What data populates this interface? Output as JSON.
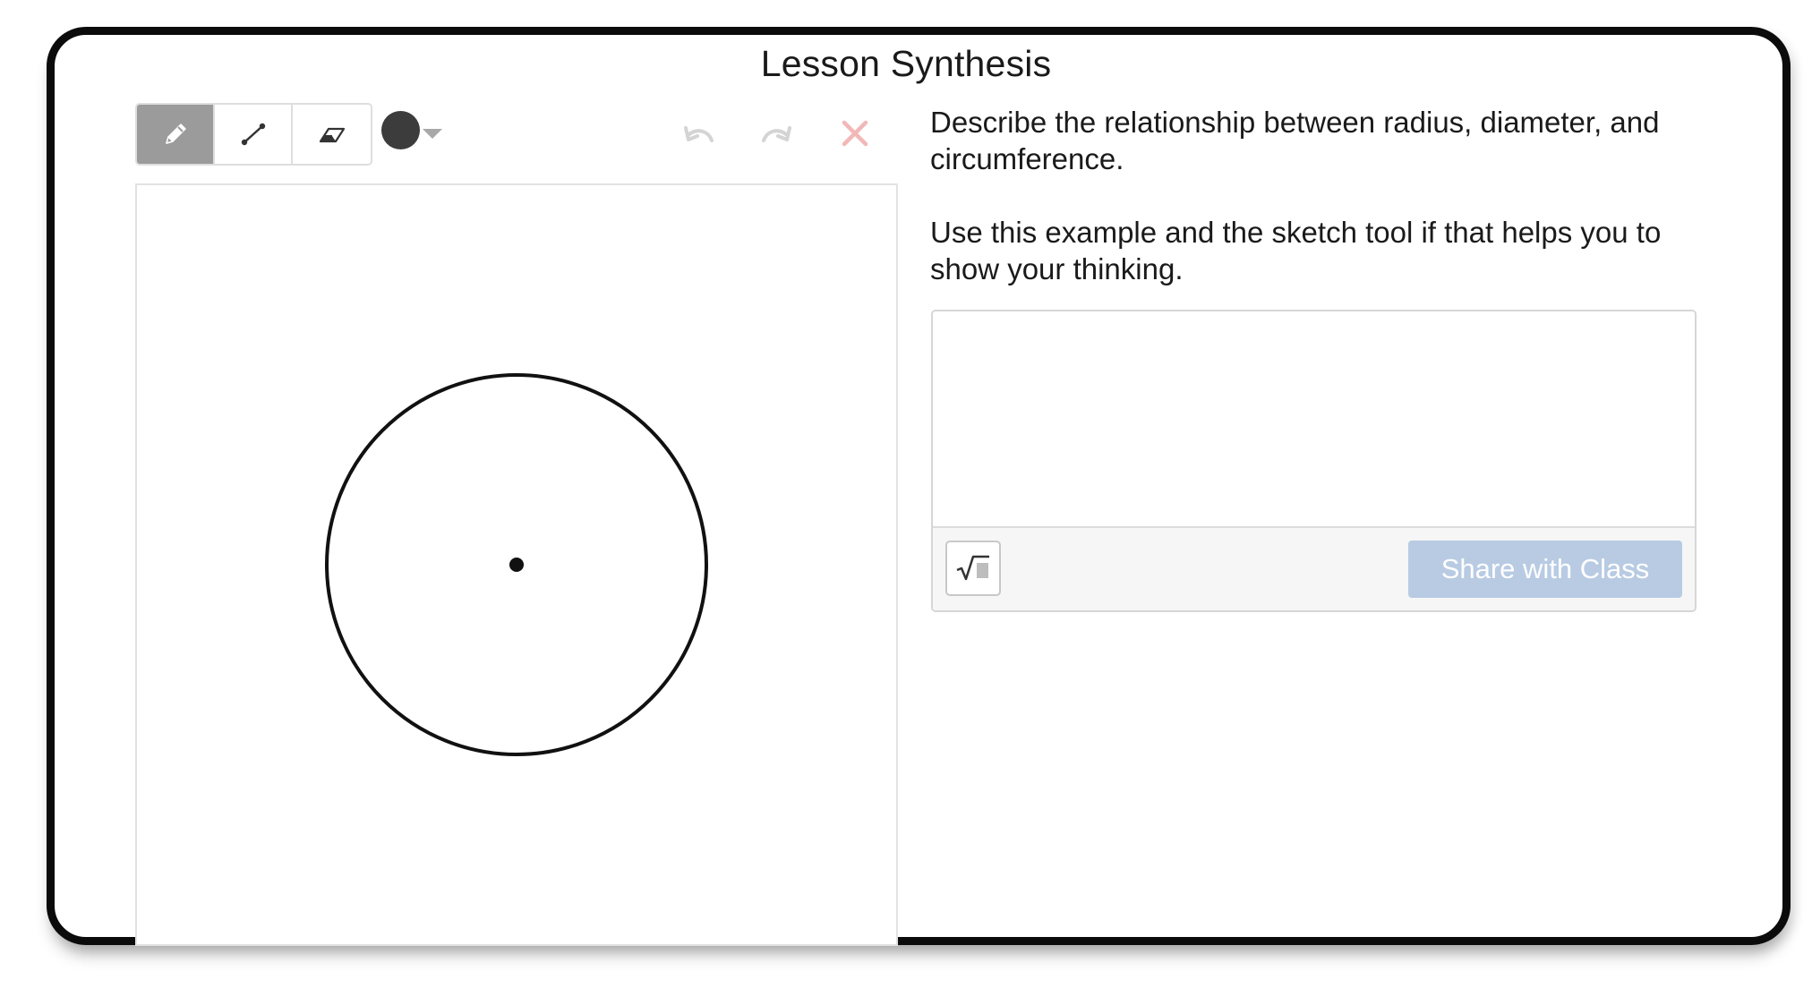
{
  "header": {
    "title": "Lesson Synthesis"
  },
  "sketch": {
    "tools": [
      {
        "name": "pencil-icon",
        "active": true
      },
      {
        "name": "line-segment-icon",
        "active": false
      },
      {
        "name": "eraser-icon",
        "active": false
      }
    ],
    "current_color": "#3c3c3c",
    "undo_enabled": false,
    "redo_enabled": false,
    "clear_color": "#f2b8b8"
  },
  "prompt": {
    "line1": "Describe the relationship between radius, diameter, and circumference.",
    "line2": "Use this example and the sketch tool if that helps you to show your thinking."
  },
  "response": {
    "value": "",
    "placeholder": "",
    "math_button_icon": "square-root-icon",
    "share_label": "Share with Class",
    "share_color": "#b8cbe3"
  }
}
